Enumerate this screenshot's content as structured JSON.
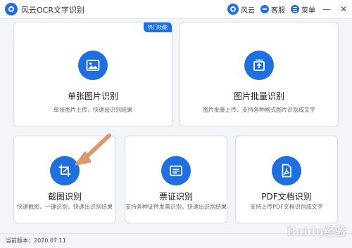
{
  "window": {
    "title": "风云OCR文字识别",
    "actions": [
      {
        "label": "风云",
        "icon": "brand-icon"
      },
      {
        "label": "客服",
        "icon": "support-icon"
      },
      {
        "label": "菜单",
        "icon": "menu-icon"
      }
    ],
    "controls": {
      "minimize": "—",
      "close": "✕"
    }
  },
  "cards": [
    {
      "title": "单张图片识别",
      "desc": "单张图片上传，快速出识别结果",
      "icon": "image-icon",
      "badge": "热门功能"
    },
    {
      "title": "图片批量识别",
      "desc": "图片批量上传，支持各种格式图片识别成文字",
      "icon": "batch-upload-icon"
    },
    {
      "title": "截图识别",
      "desc": "快速截图，一键识别，快速出识别结果",
      "icon": "crop-icon"
    },
    {
      "title": "票证识别",
      "desc": "支持各种证件发票识别，快速出识别结果",
      "icon": "id-card-icon"
    },
    {
      "title": "PDF文档识别",
      "desc": "支持上传PDF文档识别成文字",
      "icon": "pdf-icon"
    }
  ],
  "status": {
    "version": "当前版本：2020.07.11"
  },
  "watermark": "Baidu经验",
  "colors": {
    "accent": "#1f6fe0",
    "arrow": "#d99b6e"
  }
}
